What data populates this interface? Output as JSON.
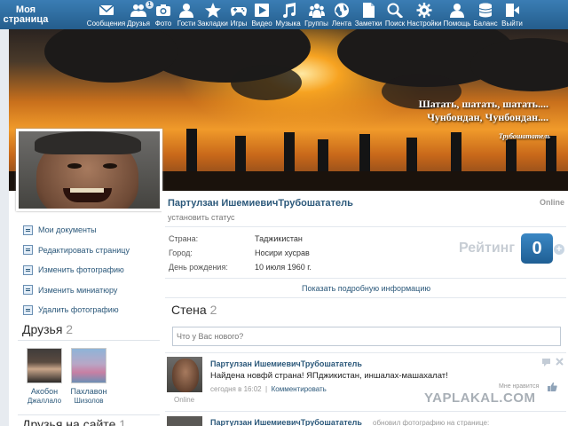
{
  "header": {
    "my_page": "Моя страница",
    "nav": [
      {
        "label": "Сообщения",
        "icon": "envelope-icon"
      },
      {
        "label": "Друзья",
        "icon": "friends-icon",
        "badge": "1"
      },
      {
        "label": "Фото",
        "icon": "camera-icon"
      },
      {
        "label": "Гости",
        "icon": "guests-icon"
      },
      {
        "label": "Закладки",
        "icon": "star-icon"
      },
      {
        "label": "Игры",
        "icon": "gamepad-icon"
      },
      {
        "label": "Видео",
        "icon": "play-icon"
      },
      {
        "label": "Музыка",
        "icon": "music-note-icon"
      },
      {
        "label": "Группы",
        "icon": "groups-icon"
      },
      {
        "label": "Лента",
        "icon": "globe-icon"
      },
      {
        "label": "Заметки",
        "icon": "note-icon"
      },
      {
        "label": "Поиск",
        "icon": "search-icon"
      },
      {
        "label": "Настройки",
        "icon": "gear-icon"
      },
      {
        "label": "Помощь",
        "icon": "help-icon"
      },
      {
        "label": "Баланс",
        "icon": "coins-icon"
      },
      {
        "label": "Выйти",
        "icon": "exit-icon"
      }
    ]
  },
  "cover": {
    "quote_line1": "Шатать, шатать, шатать....",
    "quote_line2": "Чунбондан, Чунбондан....",
    "signature": "Трубошататель"
  },
  "profile": {
    "name": "Партулзан ИшемиевичТрубошататель",
    "status": "установить статус",
    "online": "Online",
    "info": [
      {
        "label": "Страна:",
        "value": "Таджикистан"
      },
      {
        "label": "Город:",
        "value": "Носири хусрав"
      },
      {
        "label": "День рождения:",
        "value": "10 июля 1960 г."
      }
    ],
    "more_info": "Показать подробную информацию",
    "rating_label": "Рейтинг",
    "rating_value": "0",
    "rating_plus": "+"
  },
  "menu": [
    "Мои документы",
    "Редактировать страницу",
    "Изменить фотографию",
    "Изменить миниатюру",
    "Удалить фотографию"
  ],
  "friends": {
    "title": "Друзья",
    "count": "2",
    "items": [
      {
        "name": "Акобон",
        "surname": "Джаллало"
      },
      {
        "name": "Пахлавон",
        "surname": "Шизолов"
      }
    ]
  },
  "friends_online": {
    "title": "Друзья на сайте",
    "count": "1"
  },
  "wall": {
    "title": "Стена",
    "count": "2",
    "input_placeholder": "Что у Вас нового?",
    "post": {
      "author": "Партулзан ИшемиевичТрубошататель",
      "text": "Найдена новфй страна! ЯПджикистан, иншалах-машахалат!",
      "time": "сегодня в 16:02",
      "comment_link": "Комментировать",
      "online": "Online",
      "like_label": "Мне нравится"
    },
    "next_post": {
      "author": "Партулзан ИшемиевичТрубошататель",
      "action": "обновил фотографию на странице:"
    }
  },
  "watermark": "YAPLAKAL.COM"
}
